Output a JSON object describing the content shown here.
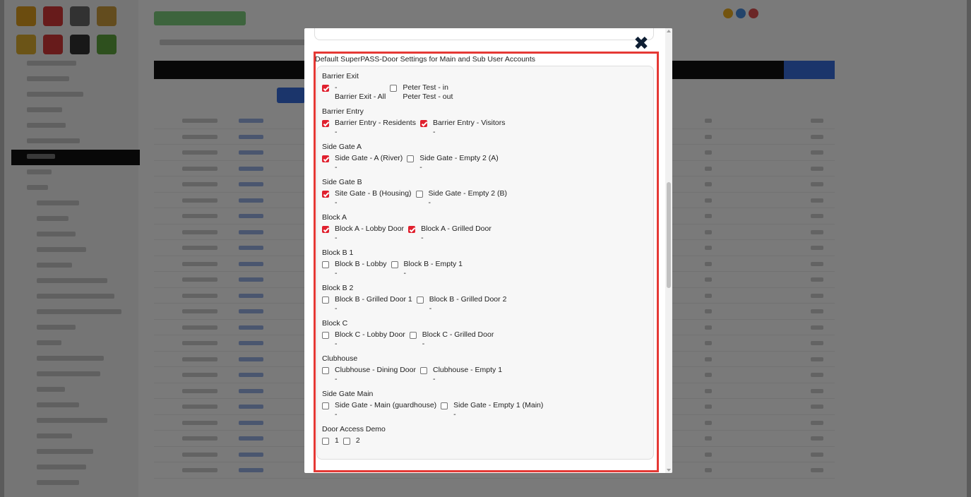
{
  "dialog": {
    "close_symbol": "✖",
    "section_title": "Default SuperPASS-Door Settings for Main and Sub User Accounts"
  },
  "groups": [
    {
      "label": "Barrier Exit",
      "items": [
        {
          "name": "-",
          "sub": "Barrier Exit - All",
          "checked": true
        },
        {
          "name": "Peter Test - in",
          "sub": "Peter Test - out",
          "checked": false
        }
      ]
    },
    {
      "label": "Barrier Entry",
      "items": [
        {
          "name": "Barrier Entry - Residents",
          "sub": "-",
          "checked": true
        },
        {
          "name": "Barrier Entry - Visitors",
          "sub": "-",
          "checked": true
        }
      ]
    },
    {
      "label": "Side Gate A",
      "items": [
        {
          "name": "Side Gate - A (River)",
          "sub": "-",
          "checked": true
        },
        {
          "name": "Side Gate - Empty 2 (A)",
          "sub": "-",
          "checked": false
        }
      ]
    },
    {
      "label": "Side Gate B",
      "items": [
        {
          "name": "Site Gate - B (Housing)",
          "sub": "-",
          "checked": true
        },
        {
          "name": "Side Gate - Empty 2 (B)",
          "sub": "-",
          "checked": false
        }
      ]
    },
    {
      "label": "Block A",
      "items": [
        {
          "name": "Block A - Lobby Door",
          "sub": "-",
          "checked": true
        },
        {
          "name": "Block A - Grilled Door",
          "sub": "-",
          "checked": true
        }
      ]
    },
    {
      "label": "Block B 1",
      "items": [
        {
          "name": "Block B - Lobby",
          "sub": "-",
          "checked": false
        },
        {
          "name": "Block B - Empty 1",
          "sub": "-",
          "checked": false
        }
      ]
    },
    {
      "label": "Block B 2",
      "items": [
        {
          "name": "Block B - Grilled Door 1",
          "sub": "-",
          "checked": false
        },
        {
          "name": "Block B - Grilled Door 2",
          "sub": "-",
          "checked": false
        }
      ]
    },
    {
      "label": "Block C",
      "items": [
        {
          "name": "Block C - Lobby Door",
          "sub": "-",
          "checked": false
        },
        {
          "name": "Block C - Grilled Door",
          "sub": "-",
          "checked": false
        }
      ]
    },
    {
      "label": "Clubhouse",
      "items": [
        {
          "name": "Clubhouse - Dining Door",
          "sub": "-",
          "checked": false
        },
        {
          "name": "Clubhouse - Empty 1",
          "sub": "-",
          "checked": false
        }
      ]
    },
    {
      "label": "Side Gate Main",
      "items": [
        {
          "name": "Side Gate - Main (guardhouse)",
          "sub": "-",
          "checked": false
        },
        {
          "name": "Side Gate - Empty 1 (Main)",
          "sub": "-",
          "checked": false
        }
      ]
    },
    {
      "label": "Door Access Demo",
      "items": [
        {
          "name": "1",
          "sub": "",
          "checked": false
        },
        {
          "name": "2",
          "sub": "",
          "checked": false
        }
      ]
    }
  ],
  "colors": {
    "checkbox_checked": "#e0202e",
    "highlight_border": "#e53935",
    "overlay": "rgba(0,0,0,0.52)"
  }
}
